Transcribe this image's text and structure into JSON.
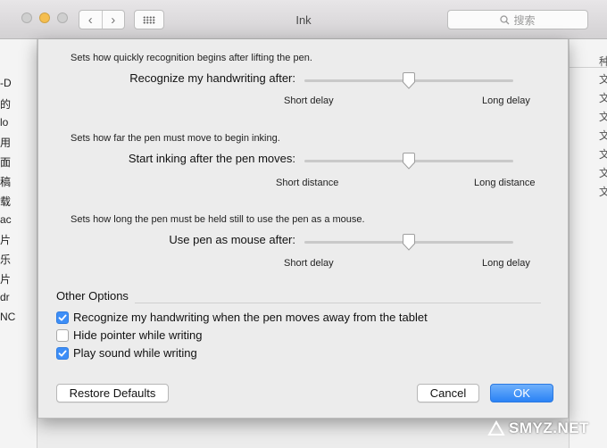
{
  "window": {
    "title": "Ink",
    "search_placeholder": "搜索"
  },
  "left_fragments": [
    "-D",
    "的",
    "lo",
    "用",
    "面",
    "稿",
    "载",
    "ac",
    "片",
    "乐",
    "片",
    "dr",
    "NC"
  ],
  "right_fragments": [
    "种",
    "文",
    "文",
    "文",
    "文",
    "文",
    "文",
    "文"
  ],
  "sliders": [
    {
      "help": "Sets how quickly recognition begins after lifting the pen.",
      "label": "Recognize my handwriting after:",
      "min_label": "Short delay",
      "max_label": "Long delay",
      "value": 0.5
    },
    {
      "help": "Sets how far the pen must move to begin inking.",
      "label": "Start inking after the pen moves:",
      "min_label": "Short distance",
      "max_label": "Long distance",
      "value": 0.5
    },
    {
      "help": "Sets how long the pen must be held still to use the pen as a mouse.",
      "label": "Use pen as mouse after:",
      "min_label": "Short delay",
      "max_label": "Long delay",
      "value": 0.5
    }
  ],
  "other_options": {
    "title": "Other Options",
    "items": [
      {
        "label": "Recognize my handwriting when the pen moves away from the tablet",
        "checked": true
      },
      {
        "label": "Hide pointer while writing",
        "checked": false
      },
      {
        "label": "Play sound while writing",
        "checked": true
      }
    ]
  },
  "buttons": {
    "restore": "Restore Defaults",
    "cancel": "Cancel",
    "ok": "OK"
  },
  "colors": {
    "accent": "#3d8ef7",
    "minimize": "#f5be4f"
  },
  "watermark": "SMYZ.NET"
}
